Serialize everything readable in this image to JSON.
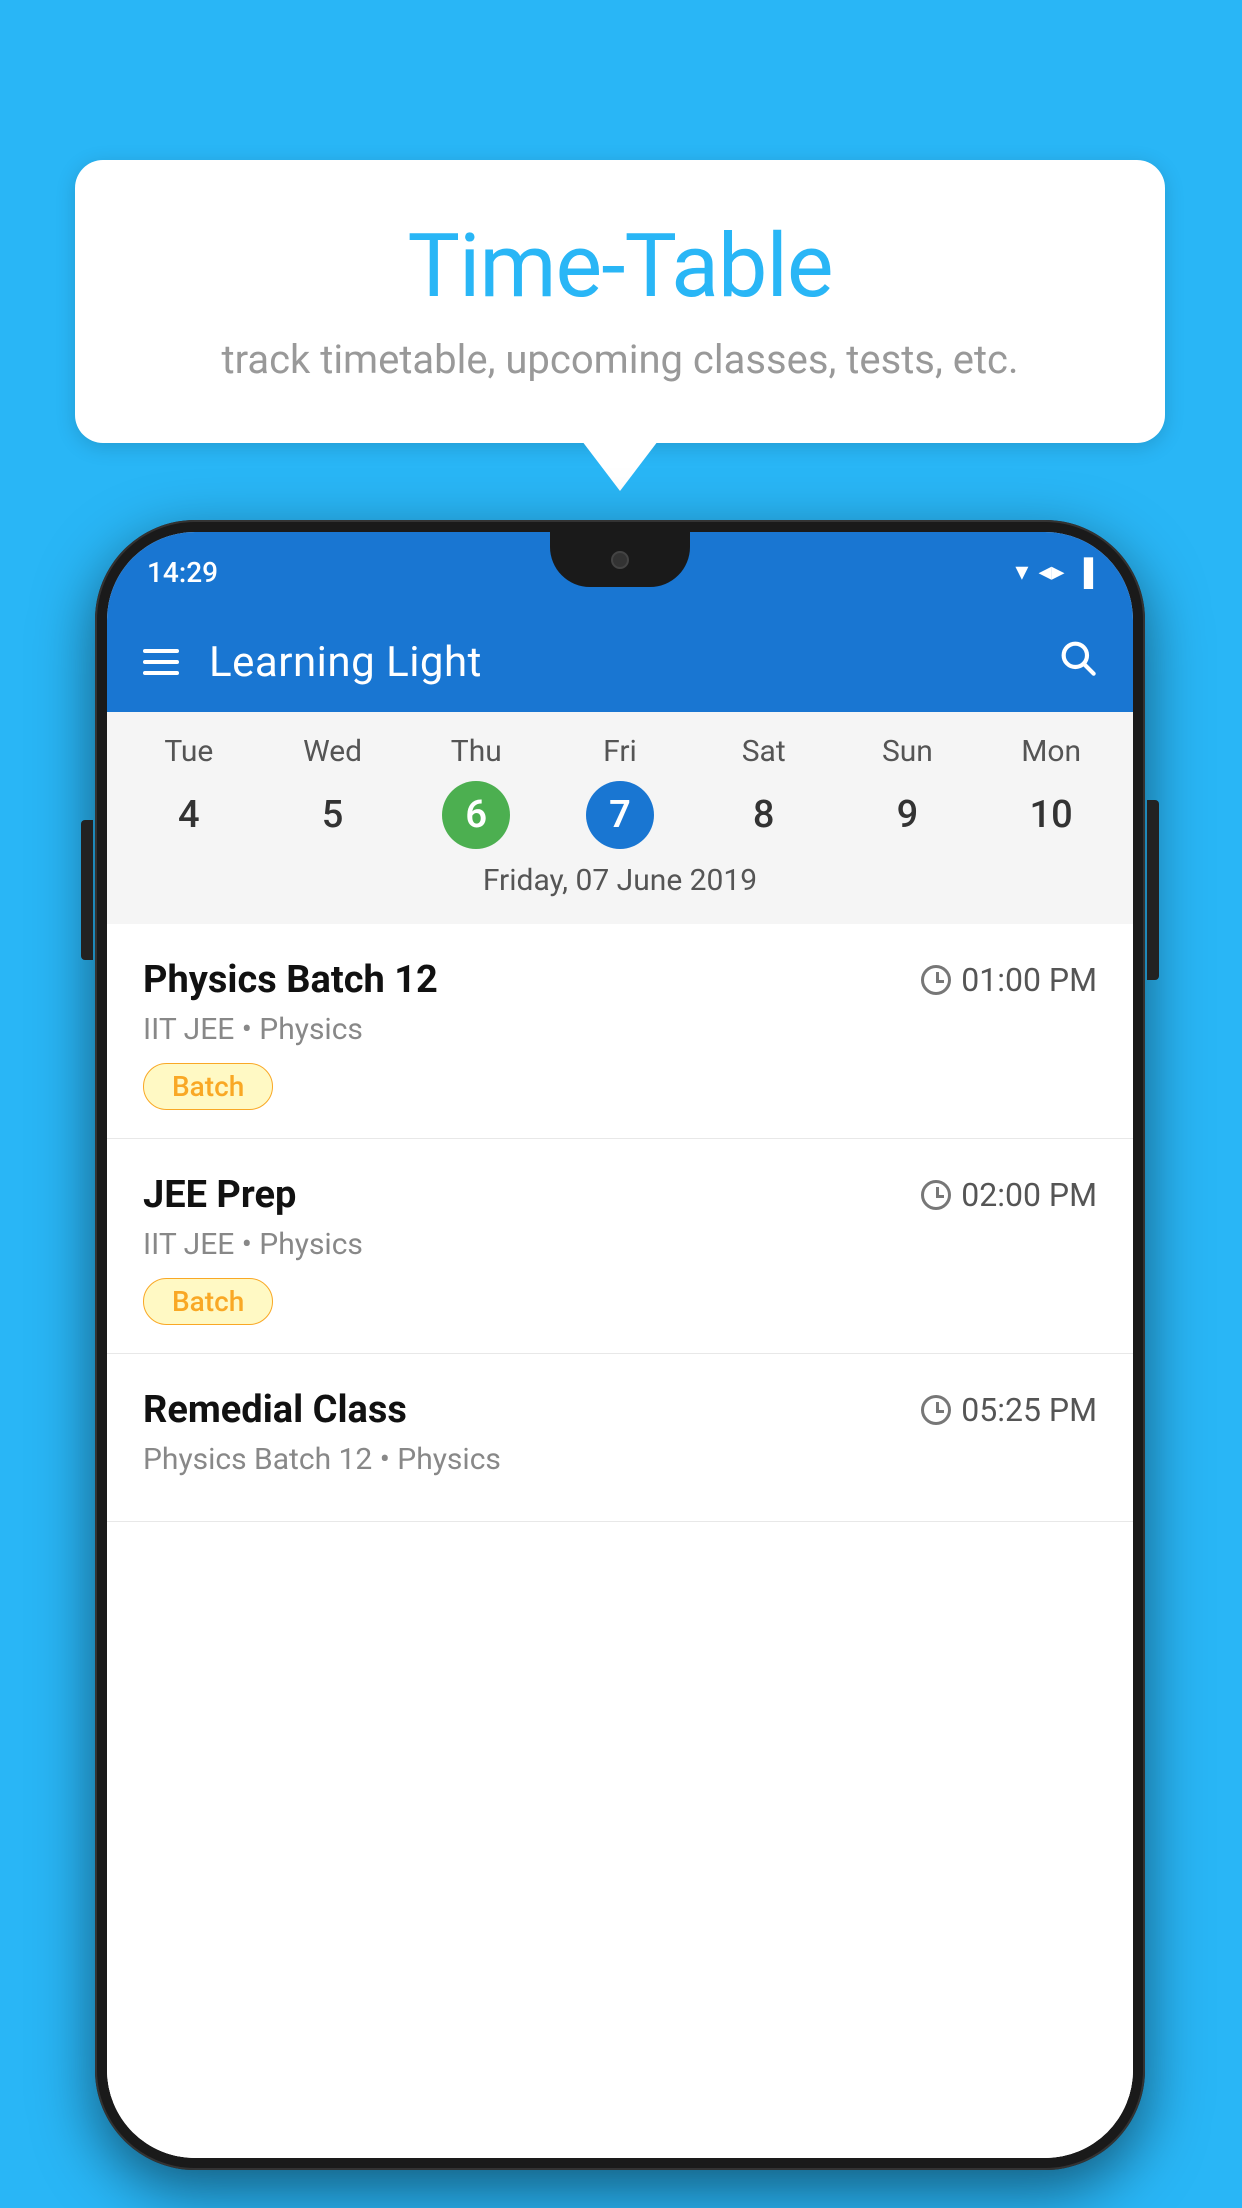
{
  "background": {
    "color": "#29B6F6"
  },
  "speech_bubble": {
    "title": "Time-Table",
    "subtitle": "track timetable, upcoming classes, tests, etc."
  },
  "phone": {
    "status_bar": {
      "time": "14:29",
      "wifi": "▼",
      "signal": "▲",
      "battery": "▌"
    },
    "app_bar": {
      "title": "Learning Light",
      "search_tooltip": "Search"
    },
    "calendar": {
      "days": [
        "Tue",
        "Wed",
        "Thu",
        "Fri",
        "Sat",
        "Sun",
        "Mon"
      ],
      "dates": [
        "4",
        "5",
        "6",
        "7",
        "8",
        "9",
        "10"
      ],
      "today_index": 2,
      "selected_index": 3,
      "selected_label": "Friday, 07 June 2019"
    },
    "schedule": [
      {
        "title": "Physics Batch 12",
        "time": "01:00 PM",
        "category": "IIT JEE • Physics",
        "badge": "Batch"
      },
      {
        "title": "JEE Prep",
        "time": "02:00 PM",
        "category": "IIT JEE • Physics",
        "badge": "Batch"
      },
      {
        "title": "Remedial Class",
        "time": "05:25 PM",
        "category": "Physics Batch 12 • Physics",
        "badge": ""
      }
    ]
  }
}
